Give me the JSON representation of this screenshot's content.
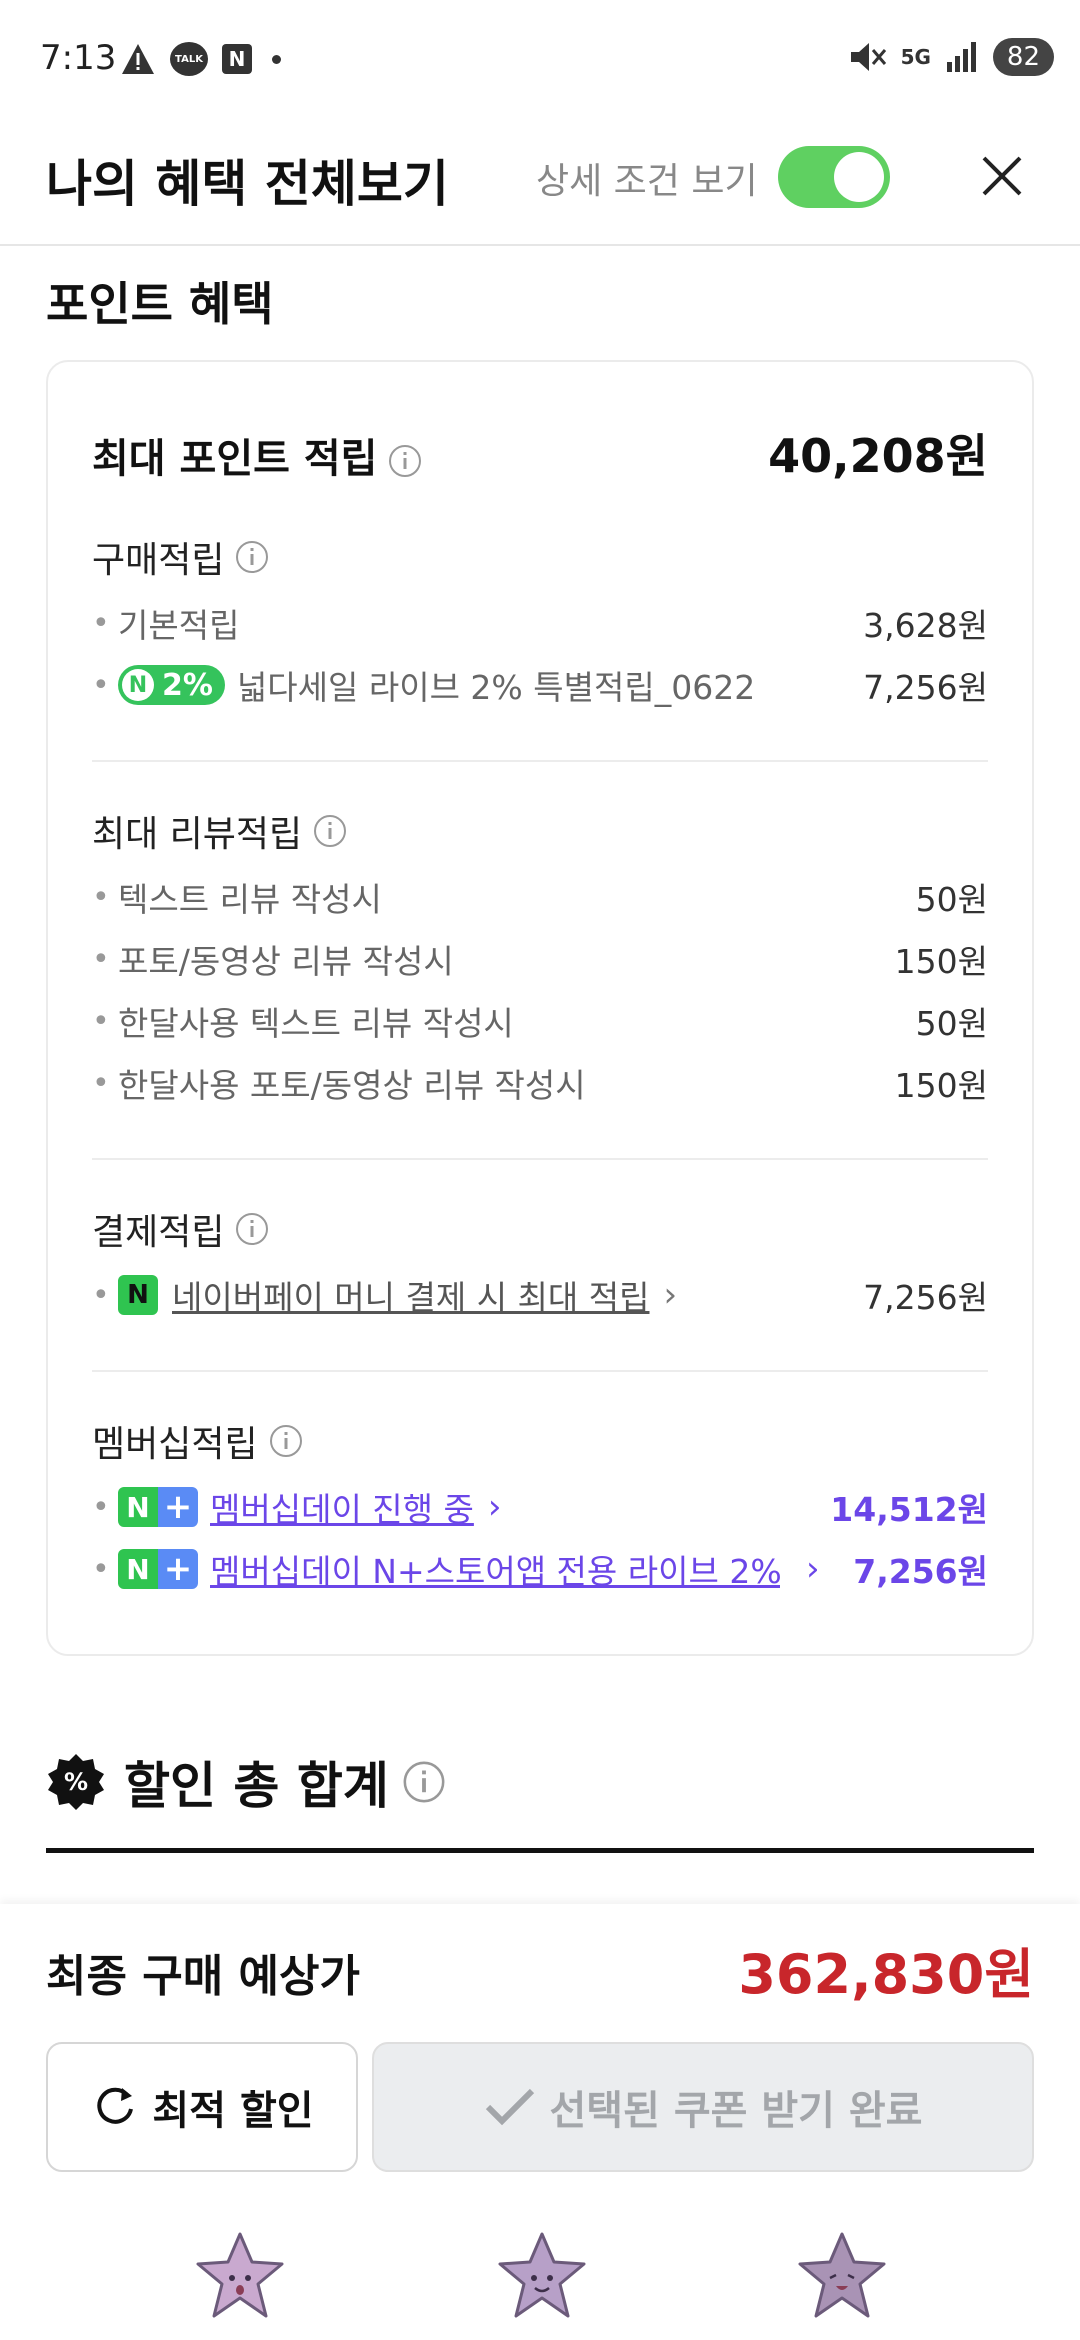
{
  "status_bar": {
    "time": "7:13",
    "talk_badge": "TALK",
    "n_badge": "N",
    "network": "5G",
    "battery": "82"
  },
  "header": {
    "title": "나의 혜택 전체보기",
    "detail_toggle_label": "상세 조건 보기",
    "detail_toggle_on": true
  },
  "point_section": {
    "title": "포인트 혜택",
    "max_label": "최대 포인트 적립",
    "max_value": "40,208원",
    "purchase": {
      "title": "구매적립",
      "items": [
        {
          "label": "기본적립",
          "value": "3,628원"
        },
        {
          "badge": "2%",
          "label": "넓다세일 라이브 2% 특별적립_0622",
          "value": "7,256원"
        }
      ]
    },
    "review": {
      "title": "최대 리뷰적립",
      "items": [
        {
          "label": "텍스트 리뷰 작성시",
          "value": "50원"
        },
        {
          "label": "포토/동영상 리뷰 작성시",
          "value": "150원"
        },
        {
          "label": "한달사용 텍스트 리뷰 작성시",
          "value": "50원"
        },
        {
          "label": "한달사용 포토/동영상 리뷰 작성시",
          "value": "150원"
        }
      ]
    },
    "payment": {
      "title": "결제적립",
      "items": [
        {
          "badge": "N",
          "label": "네이버페이 머니 결제 시 최대 적립",
          "value": "7,256원"
        }
      ]
    },
    "membership": {
      "title": "멤버십적립",
      "items": [
        {
          "badge_n": "N",
          "badge_plus": "+",
          "label": "멤버십데이 진행 중",
          "value": "14,512원"
        },
        {
          "badge_n": "N",
          "badge_plus": "+",
          "label": "멤버십데이 N+스토어앱 전용 라이브 2% ...",
          "value": "7,256원"
        }
      ]
    }
  },
  "discount_section": {
    "title": "할인 총 합계",
    "icon_text": "%"
  },
  "bottom": {
    "final_label": "최종 구매 예상가",
    "final_price": "362,830원",
    "optimal_button": "최적 할인",
    "coupon_button": "선택된 쿠폰 받기 완료"
  },
  "colors": {
    "toggle_on": "#5fd061",
    "naver_green": "#35c35c",
    "membership_purple": "#6b46e8",
    "price_red": "#c8262b"
  }
}
